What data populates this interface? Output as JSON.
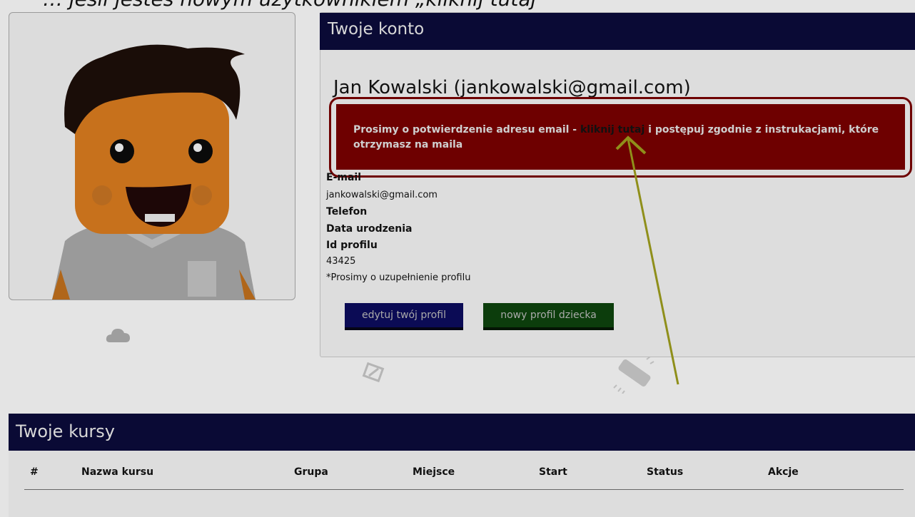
{
  "top_caption": "… jeśli jesteś nowym użytkownikiem „kliknij tutaj”",
  "account": {
    "title": "Twoje konto",
    "user_display": "Jan Kowalski (jankowalski@gmail.com)",
    "alert": {
      "before_link": "Prosimy o potwierdzenie adresu email - ",
      "link_text": "kliknij tutaj",
      "after_link": " i postępuj zgodnie z instrukacjami, które otrzymasz na maila"
    },
    "email_label": "E-mail",
    "email_value": "jankowalski@gmail.com",
    "phone_label": "Telefon",
    "birthdate_label": "Data urodzenia",
    "profile_id_label": "Id profilu",
    "profile_id_value": "43425",
    "note": "*Prosimy o uzupełnienie profilu",
    "buttons": {
      "edit": "edytuj twój profil",
      "new_child": "nowy profil dziecka"
    }
  },
  "courses": {
    "title": "Twoje kursy",
    "columns": [
      "#",
      "Nazwa kursu",
      "Grupa",
      "Miejsce",
      "Start",
      "Status",
      "Akcje"
    ]
  },
  "colors": {
    "header_bg": "#0a0a35",
    "alert_bg": "#6e0000",
    "edit_button": "#0b0b55",
    "child_button": "#0c3d0c",
    "annotation_arrow": "#8f8f1a"
  },
  "icons": {
    "avatar": "cartoon-avatar",
    "cloud": "cloud-icon",
    "pencil": "pencil-icon",
    "bandage": "bandage-icon"
  }
}
